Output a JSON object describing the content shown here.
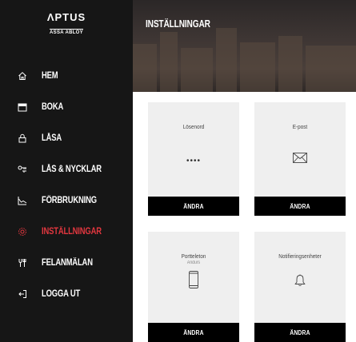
{
  "brand": {
    "logo_main": "ΛPTUS",
    "logo_sub": "ASSA ABLOY"
  },
  "page": {
    "title": "INSTÄLLNINGAR"
  },
  "nav": {
    "items": [
      {
        "label": "HEM",
        "icon": "home-icon",
        "active": false
      },
      {
        "label": "BOKA",
        "icon": "calendar-icon",
        "active": false
      },
      {
        "label": "LÅSA",
        "icon": "lock-icon",
        "active": false
      },
      {
        "label": "LÅS & NYCKLAR",
        "icon": "keys-icon",
        "active": false
      },
      {
        "label": "FÖRBRUKNING",
        "icon": "chart-icon",
        "active": false
      },
      {
        "label": "INSTÄLLNINGAR",
        "icon": "gear-icon",
        "active": true
      },
      {
        "label": "FELANMÄLAN",
        "icon": "wrench-icon",
        "active": false
      },
      {
        "label": "LOGGA UT",
        "icon": "logout-icon",
        "active": false
      }
    ]
  },
  "colors": {
    "sidebar": "#161616",
    "accent": "#e2373f",
    "card": "#efefef",
    "button": "#000000"
  },
  "cards": {
    "password": {
      "title": "Lösenord",
      "value": "••••",
      "button": "ÄNDRA"
    },
    "email": {
      "title": "E-post",
      "icon": "envelope-icon",
      "button": "ÄNDRA"
    },
    "doorphone": {
      "title": "Portteleton",
      "subtitle": "Andurs",
      "icon": "phone-icon",
      "button": "ÄNDRA"
    },
    "notifications": {
      "title": "Notifieringsenheter",
      "icon": "bell-icon",
      "button": "ÄNDRA"
    }
  }
}
